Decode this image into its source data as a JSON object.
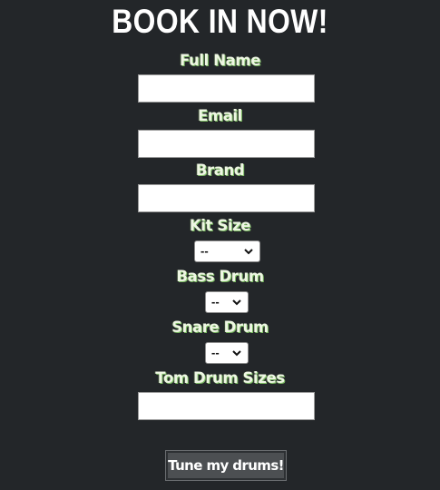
{
  "form": {
    "title": "BOOK IN NOW!",
    "full_name_label": "Full Name",
    "full_name_value": "",
    "email_label": "Email",
    "email_value": "",
    "brand_label": "Brand",
    "brand_value": "",
    "kit_size_label": "Kit Size",
    "kit_size_selected": "--",
    "bass_drum_label": "Bass Drum",
    "bass_drum_selected": "--",
    "snare_drum_label": "Snare Drum",
    "snare_drum_selected": "--",
    "tom_sizes_label": "Tom Drum Sizes",
    "tom_sizes_value": "",
    "submit_label": "Tune my drums!"
  },
  "icons": {
    "select_arrow": "chevron-down-icon"
  },
  "colors": {
    "background": "#232629",
    "label_text": "#eef6e3",
    "label_shadow": "#7cbc63",
    "button_bg": "#4c4f52"
  }
}
